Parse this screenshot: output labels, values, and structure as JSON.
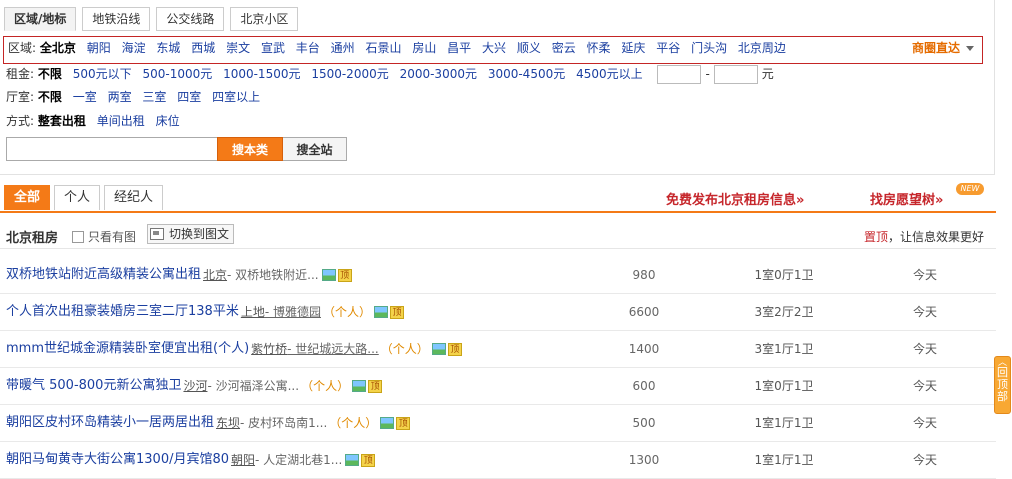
{
  "region_tabs": [
    "区域/地标",
    "地铁沿线",
    "公交线路",
    "北京小区"
  ],
  "filters": {
    "area_label": "区域:",
    "areas": [
      "全北京",
      "朝阳",
      "海淀",
      "东城",
      "西城",
      "崇文",
      "宣武",
      "丰台",
      "通州",
      "石景山",
      "房山",
      "昌平",
      "大兴",
      "顺义",
      "密云",
      "怀柔",
      "延庆",
      "平谷",
      "门头沟",
      "北京周边"
    ],
    "shangquan": "商圈直达",
    "rent_label": "租金:",
    "rents": [
      "不限",
      "500元以下",
      "500-1000元",
      "1000-1500元",
      "1500-2000元",
      "2000-3000元",
      "3000-4500元",
      "4500元以上"
    ],
    "rent_sep": "-",
    "rent_unit": "元",
    "room_label": "厅室:",
    "rooms": [
      "不限",
      "一室",
      "两室",
      "三室",
      "四室",
      "四室以上"
    ],
    "mode_label": "方式:",
    "modes": [
      "整套出租",
      "单间出租",
      "床位"
    ]
  },
  "search": {
    "value": "",
    "btn_local": "搜本类",
    "btn_site": "搜全站"
  },
  "list_tabs": [
    "全部",
    "个人",
    "经纪人"
  ],
  "promo": {
    "free_post": "免费发布北京租房信息»",
    "wish_tree": "找房愿望树»",
    "new_badge": "NEW"
  },
  "list_header": {
    "title": "北京租房",
    "only_img": "只看有图",
    "switch": "切换到图文",
    "tip_red": "置顶",
    "tip_rest": "，让信息效果更好"
  },
  "listings": [
    {
      "title": "双桥地铁站附近高级精装公寓出租",
      "area": "北京",
      "addr": " - 双桥地铁附近...",
      "addr_link": false,
      "person": "",
      "price": "980",
      "rooms": "1室0厅1卫",
      "date": "今天"
    },
    {
      "title": "个人首次出租豪装婚房三室二厅138平米",
      "area": "上地",
      "addr": " - 博雅德园",
      "addr_link": true,
      "person": "（个人）",
      "price": "6600",
      "rooms": "3室2厅2卫",
      "date": "今天"
    },
    {
      "title": "mmm世纪城金源精装卧室便宜出租(个人)",
      "area": "紫竹桥",
      "addr": " - 世纪城远大路...",
      "addr_link": true,
      "person": "（个人）",
      "price": "1400",
      "rooms": "3室1厅1卫",
      "date": "今天"
    },
    {
      "title": "带暖气 500-800元新公寓独卫",
      "area": "沙河",
      "addr": " - 沙河福泽公寓...",
      "addr_link": false,
      "person": "（个人）",
      "price": "600",
      "rooms": "1室0厅1卫",
      "date": "今天"
    },
    {
      "title": "朝阳区皮村环岛精装小一居两居出租",
      "area": "东坝",
      "addr": " - 皮村环岛南1...",
      "addr_link": false,
      "person": "（个人）",
      "price": "500",
      "rooms": "1室1厅1卫",
      "date": "今天"
    },
    {
      "title": "朝阳马甸黄寺大街公寓1300/月宾馆80",
      "area": "朝阳",
      "addr": " - 人定湖北巷1...",
      "addr_link": false,
      "person": "",
      "price": "1300",
      "rooms": "1室1厅1卫",
      "date": "今天"
    }
  ],
  "back_top": "回顶部"
}
